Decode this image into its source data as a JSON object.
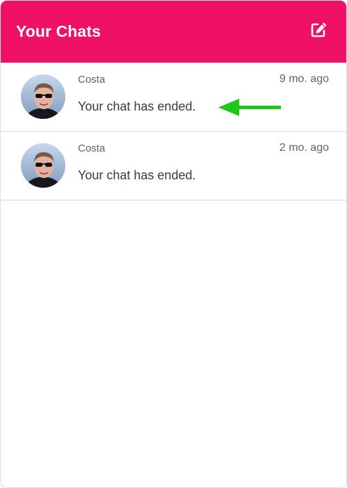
{
  "header": {
    "title": "Your Chats",
    "compose_icon": "edit-icon",
    "background_color": "#ef1166"
  },
  "chats": [
    {
      "sender": "Costa",
      "time": "9 mo. ago",
      "message": "Your chat has ended.",
      "avatar": "person-with-sunglasses"
    },
    {
      "sender": "Costa",
      "time": "2 mo. ago",
      "message": "Your chat has ended.",
      "avatar": "person-with-sunglasses"
    }
  ],
  "annotation": {
    "arrow_icon": "arrow-left-icon",
    "arrow_color": "#21c51a"
  }
}
